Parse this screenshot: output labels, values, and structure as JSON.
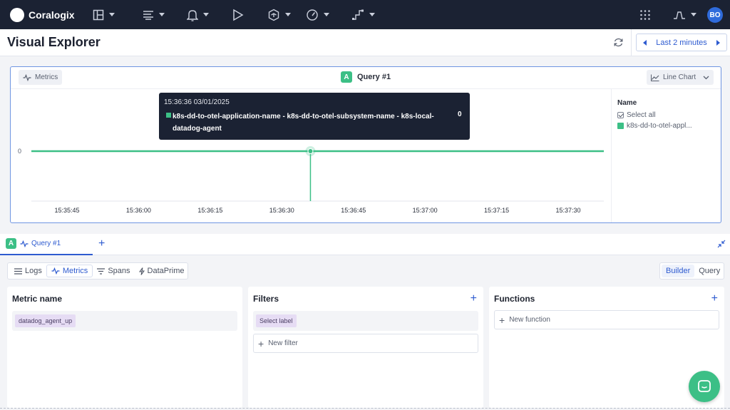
{
  "topbar": {
    "brand": "Coralogix",
    "nav_icons": [
      "dashboard-icon",
      "explore-icon",
      "alerts-icon",
      "play-icon",
      "integrations-icon",
      "gauge-icon",
      "flow-icon"
    ],
    "user_initials": "BO"
  },
  "header": {
    "title": "Visual Explorer",
    "time_range": "Last 2 minutes"
  },
  "chart_panel": {
    "source_label": "Metrics",
    "query_badge": "A",
    "query_title": "Query #1",
    "chart_type_label": "Line Chart",
    "legend": {
      "heading": "Name",
      "select_all": "Select all",
      "series_short": "k8s-dd-to-otel-appl..."
    },
    "tooltip": {
      "time": "15:36:36 03/01/2025",
      "series": "k8s-dd-to-otel-application-name - k8s-dd-to-otel-subsystem-name - k8s-local-datadog-agent",
      "value": "0"
    }
  },
  "chart_data": {
    "type": "line",
    "x": [
      "15:35:45",
      "15:36:00",
      "15:36:15",
      "15:36:30",
      "15:36:45",
      "15:37:00",
      "15:37:15",
      "15:37:30"
    ],
    "series": [
      {
        "name": "k8s-dd-to-otel-application-name - k8s-dd-to-otel-subsystem-name - k8s-local-datadog-agent",
        "values": [
          0,
          0,
          0,
          0,
          0,
          0,
          0,
          0
        ],
        "color": "#3cbf86"
      }
    ],
    "y_ticks": [
      "0"
    ],
    "hover_x": "15:36:36",
    "grid": false,
    "legend_position": "right"
  },
  "query_tabs": {
    "active_badge": "A",
    "active_label": "Query #1",
    "add_label": "+"
  },
  "sources": {
    "items": [
      "Logs",
      "Metrics",
      "Spans",
      "DataPrime"
    ],
    "active": "Metrics"
  },
  "modes": {
    "items": [
      "Builder",
      "Query"
    ],
    "active": "Builder"
  },
  "metric_card": {
    "title": "Metric name",
    "value": "datadog_agent_up"
  },
  "filters_card": {
    "title": "Filters",
    "select_label": "Select label",
    "new_filter": "New filter"
  },
  "functions_card": {
    "title": "Functions",
    "new_function": "New function"
  },
  "colors": {
    "topbar": "#1b2233",
    "accent": "#2e5bd0",
    "series": "#3cbf86"
  }
}
